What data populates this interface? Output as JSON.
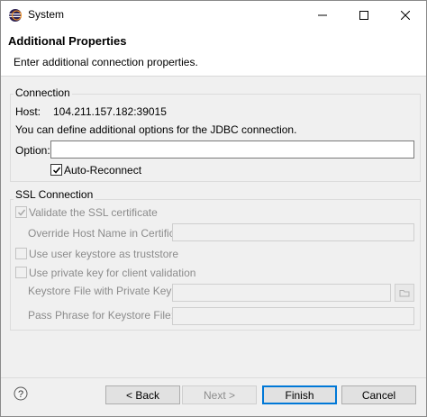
{
  "window": {
    "title": "System"
  },
  "header": {
    "title": "Additional Properties",
    "description": "Enter additional connection properties."
  },
  "connection": {
    "group_label": "Connection",
    "host_label": "Host:",
    "host_value": "104.211.157.182:39015",
    "info": "You can define additional options for the JDBC connection.",
    "option_label": "Option:",
    "option_value": "",
    "auto_reconnect_label": "Auto-Reconnect",
    "auto_reconnect_checked": true
  },
  "ssl": {
    "group_label": "SSL Connection",
    "validate_label": "Validate the SSL certificate",
    "override_label": "Override Host Name in Certificate:",
    "user_keystore_label": "Use user keystore as truststore",
    "private_key_label": "Use private key for client validation",
    "keystore_file_label": "Keystore File with Private Key:",
    "pass_phrase_label": "Pass Phrase for Keystore File:"
  },
  "buttons": {
    "help": "?",
    "back": "< Back",
    "next": "Next >",
    "finish": "Finish",
    "cancel": "Cancel"
  },
  "colors": {
    "accent": "#0078d7",
    "disabled_text": "#8c8c8c"
  }
}
